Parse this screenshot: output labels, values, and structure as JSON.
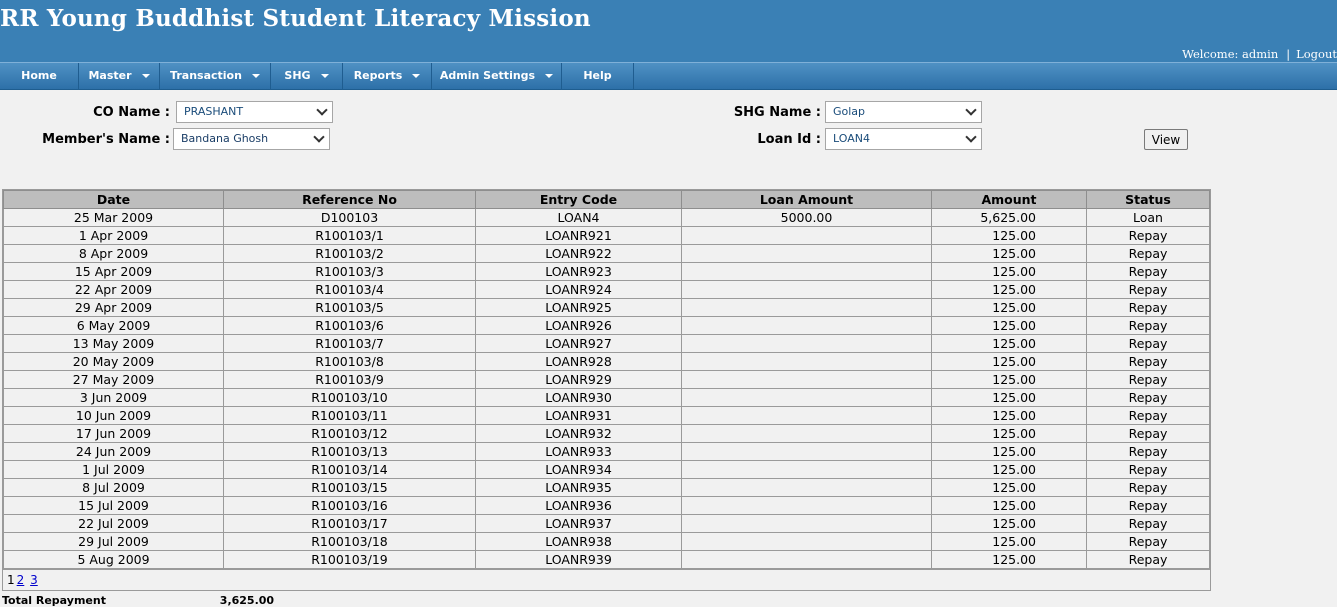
{
  "header": {
    "title": "RR Young Buddhist Student Literacy Mission",
    "welcome_prefix": "Welcome: admin",
    "separator": "|",
    "logout": "Logout"
  },
  "nav": [
    {
      "label": "Home",
      "dropdown": false
    },
    {
      "label": "Master",
      "dropdown": true
    },
    {
      "label": "Transaction",
      "dropdown": true
    },
    {
      "label": "SHG",
      "dropdown": true
    },
    {
      "label": "Reports",
      "dropdown": true
    },
    {
      "label": "Admin Settings",
      "dropdown": true
    },
    {
      "label": "Help",
      "dropdown": false
    }
  ],
  "filters": {
    "co_name_label": "CO Name :",
    "co_name_value": "PRASHANT",
    "member_label": "Member's Name :",
    "member_value": "Bandana Ghosh",
    "shg_label": "SHG Name :",
    "shg_value": "Golap",
    "loan_label": "Loan Id :",
    "loan_value": "LOAN4",
    "view_label": "View"
  },
  "table": {
    "columns": [
      "Date",
      "Reference No",
      "Entry Code",
      "Loan Amount",
      "Amount",
      "Status"
    ],
    "rows": [
      [
        "25 Mar 2009",
        "D100103",
        "LOAN4",
        "5000.00",
        "5,625.00",
        "Loan"
      ],
      [
        "1 Apr 2009",
        "R100103/1",
        "LOANR921",
        "",
        "125.00",
        "Repay"
      ],
      [
        "8 Apr 2009",
        "R100103/2",
        "LOANR922",
        "",
        "125.00",
        "Repay"
      ],
      [
        "15 Apr 2009",
        "R100103/3",
        "LOANR923",
        "",
        "125.00",
        "Repay"
      ],
      [
        "22 Apr 2009",
        "R100103/4",
        "LOANR924",
        "",
        "125.00",
        "Repay"
      ],
      [
        "29 Apr 2009",
        "R100103/5",
        "LOANR925",
        "",
        "125.00",
        "Repay"
      ],
      [
        "6 May 2009",
        "R100103/6",
        "LOANR926",
        "",
        "125.00",
        "Repay"
      ],
      [
        "13 May 2009",
        "R100103/7",
        "LOANR927",
        "",
        "125.00",
        "Repay"
      ],
      [
        "20 May 2009",
        "R100103/8",
        "LOANR928",
        "",
        "125.00",
        "Repay"
      ],
      [
        "27 May 2009",
        "R100103/9",
        "LOANR929",
        "",
        "125.00",
        "Repay"
      ],
      [
        "3 Jun 2009",
        "R100103/10",
        "LOANR930",
        "",
        "125.00",
        "Repay"
      ],
      [
        "10 Jun 2009",
        "R100103/11",
        "LOANR931",
        "",
        "125.00",
        "Repay"
      ],
      [
        "17 Jun 2009",
        "R100103/12",
        "LOANR932",
        "",
        "125.00",
        "Repay"
      ],
      [
        "24 Jun 2009",
        "R100103/13",
        "LOANR933",
        "",
        "125.00",
        "Repay"
      ],
      [
        "1 Jul 2009",
        "R100103/14",
        "LOANR934",
        "",
        "125.00",
        "Repay"
      ],
      [
        "8 Jul 2009",
        "R100103/15",
        "LOANR935",
        "",
        "125.00",
        "Repay"
      ],
      [
        "15 Jul 2009",
        "R100103/16",
        "LOANR936",
        "",
        "125.00",
        "Repay"
      ],
      [
        "22 Jul 2009",
        "R100103/17",
        "LOANR937",
        "",
        "125.00",
        "Repay"
      ],
      [
        "29 Jul 2009",
        "R100103/18",
        "LOANR938",
        "",
        "125.00",
        "Repay"
      ],
      [
        "5 Aug 2009",
        "R100103/19",
        "LOANR939",
        "",
        "125.00",
        "Repay"
      ]
    ]
  },
  "pager": {
    "current": "1",
    "pages": [
      "2",
      "3"
    ]
  },
  "footer": {
    "total_label": "Total Repayment",
    "total_value": "3,625.00"
  }
}
